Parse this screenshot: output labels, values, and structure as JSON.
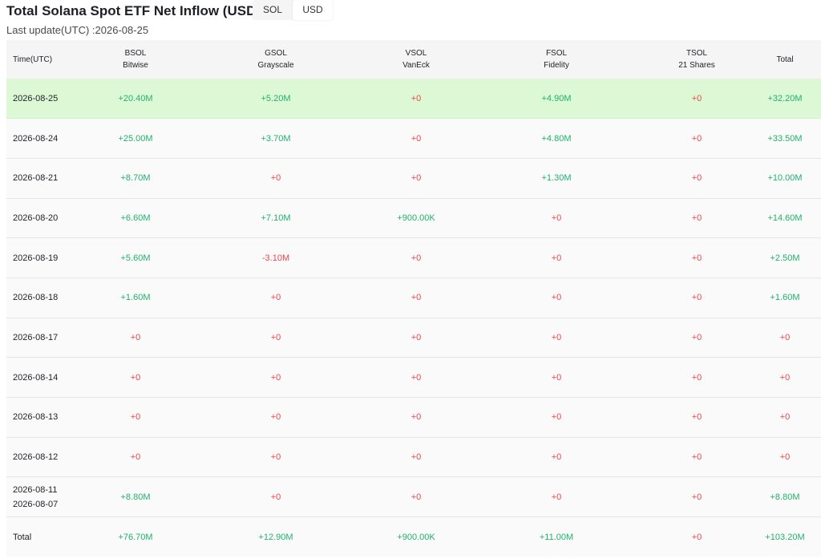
{
  "header": {
    "title": "Total Solana Spot ETF Net Inflow (USD)",
    "last_update": "Last update(UTC) :2026-08-25",
    "toggle": [
      "SOL",
      "USD"
    ],
    "toggle_active": "USD"
  },
  "colors": {
    "positive": "#20b26c",
    "zero": "#ef454a",
    "negative": "#ef454a",
    "highlight": "#ddf8d5"
  },
  "columns": [
    {
      "key": "time",
      "label": "Time(UTC)",
      "sub": ""
    },
    {
      "key": "bsol",
      "label": "BSOL",
      "sub": "Bitwise"
    },
    {
      "key": "gsol",
      "label": "GSOL",
      "sub": "Grayscale"
    },
    {
      "key": "vsol",
      "label": "VSOL",
      "sub": "VanEck"
    },
    {
      "key": "fsol",
      "label": "FSOL",
      "sub": "Fidelity"
    },
    {
      "key": "tsol",
      "label": "TSOL",
      "sub": "21 Shares"
    },
    {
      "key": "total",
      "label": "Total",
      "sub": ""
    }
  ],
  "rows": [
    {
      "time": [
        "2026-08-25"
      ],
      "bsol": "+20.40M",
      "gsol": "+5.20M",
      "vsol": "+0",
      "fsol": "+4.90M",
      "tsol": "+0",
      "total": "+32.20M",
      "highlight": true
    },
    {
      "time": [
        "2026-08-24"
      ],
      "bsol": "+25.00M",
      "gsol": "+3.70M",
      "vsol": "+0",
      "fsol": "+4.80M",
      "tsol": "+0",
      "total": "+33.50M"
    },
    {
      "time": [
        "2026-08-21"
      ],
      "bsol": "+8.70M",
      "gsol": "+0",
      "vsol": "+0",
      "fsol": "+1.30M",
      "tsol": "+0",
      "total": "+10.00M"
    },
    {
      "time": [
        "2026-08-20"
      ],
      "bsol": "+6.60M",
      "gsol": "+7.10M",
      "vsol": "+900.00K",
      "fsol": "+0",
      "tsol": "+0",
      "total": "+14.60M"
    },
    {
      "time": [
        "2026-08-19"
      ],
      "bsol": "+5.60M",
      "gsol": "-3.10M",
      "vsol": "+0",
      "fsol": "+0",
      "tsol": "+0",
      "total": "+2.50M"
    },
    {
      "time": [
        "2026-08-18"
      ],
      "bsol": "+1.60M",
      "gsol": "+0",
      "vsol": "+0",
      "fsol": "+0",
      "tsol": "+0",
      "total": "+1.60M"
    },
    {
      "time": [
        "2026-08-17"
      ],
      "bsol": "+0",
      "gsol": "+0",
      "vsol": "+0",
      "fsol": "+0",
      "tsol": "+0",
      "total": "+0"
    },
    {
      "time": [
        "2026-08-14"
      ],
      "bsol": "+0",
      "gsol": "+0",
      "vsol": "+0",
      "fsol": "+0",
      "tsol": "+0",
      "total": "+0"
    },
    {
      "time": [
        "2026-08-13"
      ],
      "bsol": "+0",
      "gsol": "+0",
      "vsol": "+0",
      "fsol": "+0",
      "tsol": "+0",
      "total": "+0"
    },
    {
      "time": [
        "2026-08-12"
      ],
      "bsol": "+0",
      "gsol": "+0",
      "vsol": "+0",
      "fsol": "+0",
      "tsol": "+0",
      "total": "+0"
    },
    {
      "time": [
        "2026-08-11",
        "2026-08-07"
      ],
      "bsol": "+8.80M",
      "gsol": "+0",
      "vsol": "+0",
      "fsol": "+0",
      "tsol": "+0",
      "total": "+8.80M"
    }
  ],
  "totals": {
    "label": "Total",
    "bsol": "+76.70M",
    "gsol": "+12.90M",
    "vsol": "+900.00K",
    "fsol": "+11.00M",
    "tsol": "+0",
    "total": "+103.20M"
  }
}
